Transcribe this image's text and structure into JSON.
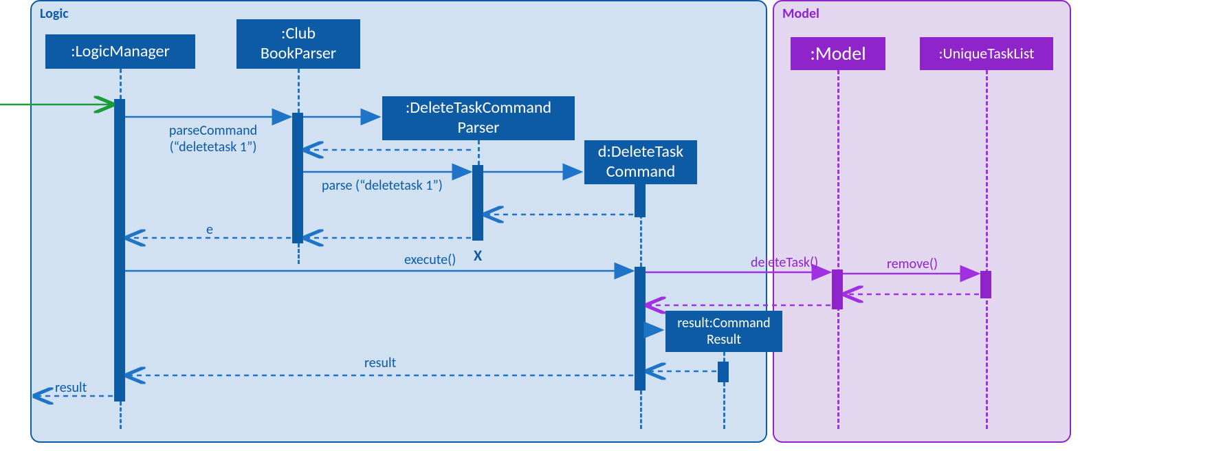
{
  "frames": {
    "logic": {
      "label": "Logic"
    },
    "model": {
      "label": "Model"
    }
  },
  "participants": {
    "logicManager": ":LogicManager",
    "clubBookParser": ":Club BookParser",
    "deleteTaskCommandParser": ":DeleteTaskCommand Parser",
    "deleteTaskCommand": "d:DeleteTask Command",
    "commandResult": "result:Command Result",
    "model": ":Model",
    "uniqueTaskList": ":UniqueTaskList"
  },
  "messages": {
    "parseCommand": "parseCommand (“deletetask 1”)",
    "parse": "parse (“deletetask 1”)",
    "e": "e",
    "execute": "execute()",
    "deleteTask": "deleteTask()",
    "remove": "remove()",
    "resultReturn": "result",
    "resultFinal": "result"
  },
  "colors": {
    "blueFill": "#0d5ba4",
    "blueLine": "#1f74c7",
    "logicFrameBg": "#d1e1f1",
    "logicFrameBorder": "#0d5ba4",
    "modelFrameBg": "#e3d6ef",
    "modelFrameBorder": "#8e24c9",
    "purpleFill": "#8e24c9",
    "purpleLine": "#a030e0",
    "green": "#1a9c3b"
  }
}
